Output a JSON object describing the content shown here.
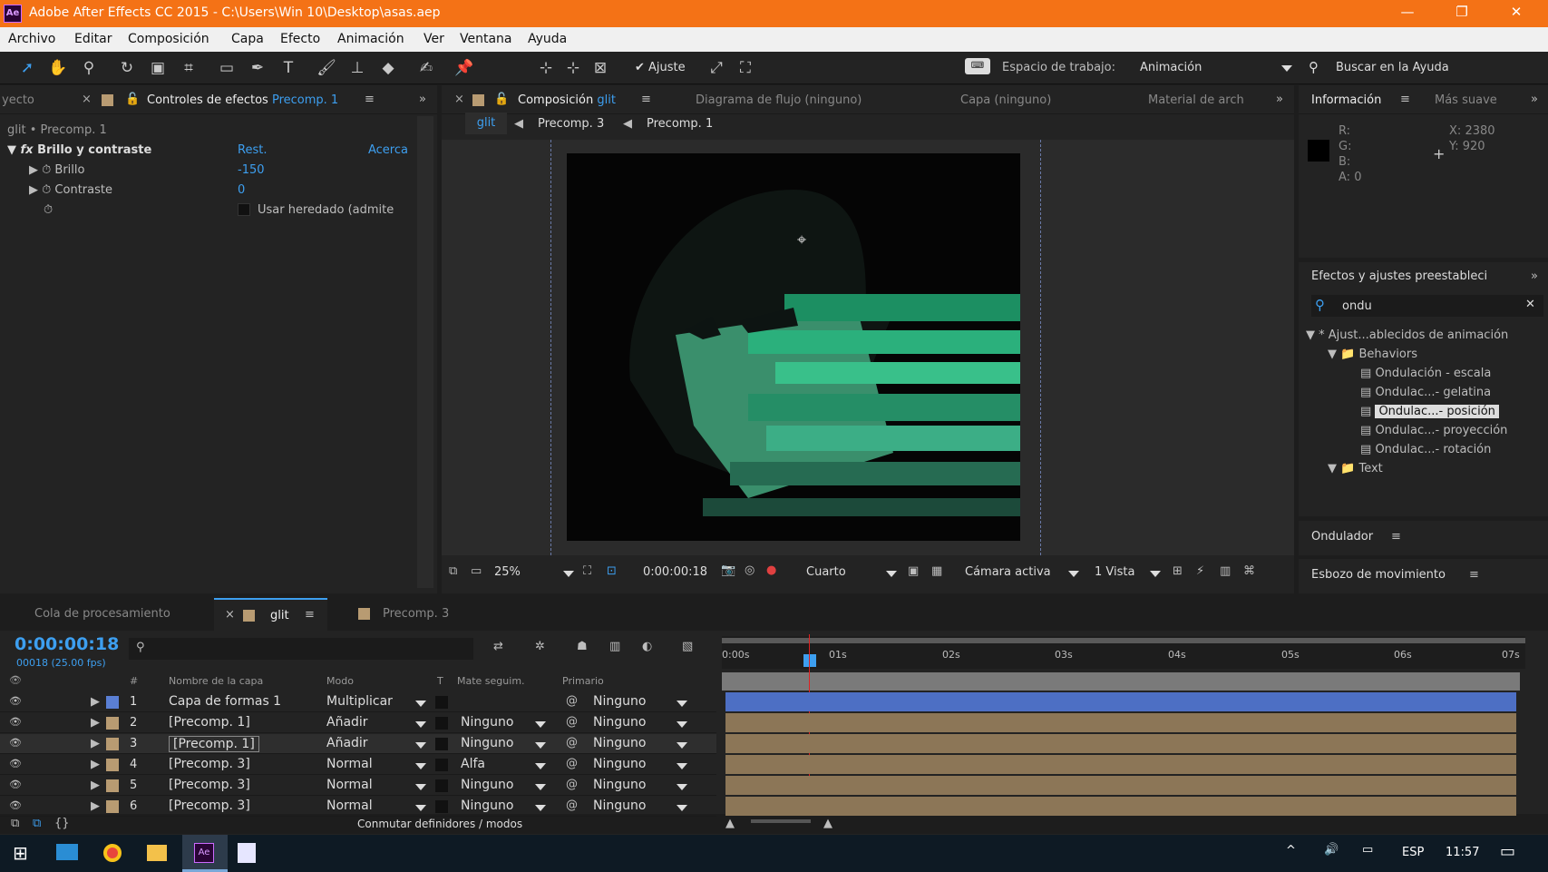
{
  "window": {
    "title": "Adobe After Effects CC 2015 - C:\\Users\\Win 10\\Desktop\\asas.aep",
    "logo": "Ae"
  },
  "menu": [
    "Archivo",
    "Editar",
    "Composición",
    "Capa",
    "Efecto",
    "Animación",
    "Ver",
    "Ventana",
    "Ayuda"
  ],
  "toolbar": {
    "snap_label": "Ajuste",
    "workspace_label": "Espacio de trabajo:",
    "workspace_value": "Animación",
    "help_placeholder": "Buscar en la Ayuda"
  },
  "effects_panel": {
    "tab_left": "yecto",
    "tab_title": "Controles de efectos",
    "tab_target": "Precomp. 1",
    "breadcrumb": "glit • Precomp. 1",
    "effect_name": "Brillo y contraste",
    "reset": "Rest.",
    "about": "Acerca",
    "props": [
      {
        "name": "Brillo",
        "value": "-150"
      },
      {
        "name": "Contraste",
        "value": "0"
      }
    ],
    "legacy": "Usar heredado (admite"
  },
  "comp_panel": {
    "tab_title": "Composición",
    "tab_target": "glit",
    "tab_flow": "Diagrama de flujo (ninguno)",
    "tab_layer": "Capa (ninguno)",
    "tab_footage": "Material de arch",
    "crumbs": [
      "glit",
      "Precomp. 3",
      "Precomp. 1"
    ],
    "zoom": "25%",
    "timecode": "0:00:00:18",
    "resolution": "Cuarto",
    "camera": "Cámara activa",
    "views": "1 Vista"
  },
  "info_panel": {
    "tab": "Información",
    "tab2": "Más suave",
    "r": "R:",
    "g": "G:",
    "b": "B:",
    "a": "A:",
    "a_val": "0",
    "x": "X:",
    "x_val": "2380",
    "y": "Y:",
    "y_val": "920"
  },
  "presets_panel": {
    "title": "Efectos y ajustes preestableci",
    "search": "ondu",
    "tree": [
      {
        "label": "* Ajust...ablecidos de animación",
        "level": 0
      },
      {
        "label": "Behaviors",
        "level": 1
      },
      {
        "label": "Ondulación - escala",
        "level": 2
      },
      {
        "label": "Ondulac...- gelatina",
        "level": 2
      },
      {
        "label": "Ondulac...- posición",
        "level": 2,
        "selected": true
      },
      {
        "label": "Ondulac...- proyección",
        "level": 2
      },
      {
        "label": "Ondulac...- rotación",
        "level": 2
      },
      {
        "label": "Text",
        "level": 1
      }
    ]
  },
  "wiggler": "Ondulador",
  "motion_sketch": "Esbozo de movimiento",
  "timeline": {
    "tabs": [
      "Cola de procesamiento",
      "glit",
      "Precomp. 3"
    ],
    "timecode": "0:00:00:18",
    "fps": "00018 (25.00 fps)",
    "headers": {
      "num": "#",
      "name": "Nombre de la capa",
      "mode": "Modo",
      "t": "T",
      "matte": "Mate seguim.",
      "parent": "Primario"
    },
    "ruler": [
      "0:00s",
      "01s",
      "02s",
      "03s",
      "04s",
      "05s",
      "06s",
      "07s"
    ],
    "layers": [
      {
        "num": "1",
        "name": "Capa de formas 1",
        "mode": "Multiplicar",
        "matte": "",
        "parent": "Ninguno",
        "color": "#5a7fd4"
      },
      {
        "num": "2",
        "name": "[Precomp. 1]",
        "mode": "Añadir",
        "matte": "Ninguno",
        "parent": "Ninguno",
        "color": "#b89b72"
      },
      {
        "num": "3",
        "name": "[Precomp. 1]",
        "mode": "Añadir",
        "matte": "Ninguno",
        "parent": "Ninguno",
        "color": "#b89b72"
      },
      {
        "num": "4",
        "name": "[Precomp. 3]",
        "mode": "Normal",
        "matte": "Alfa",
        "parent": "Ninguno",
        "color": "#b89b72"
      },
      {
        "num": "5",
        "name": "[Precomp. 3]",
        "mode": "Normal",
        "matte": "Ninguno",
        "parent": "Ninguno",
        "color": "#b89b72"
      },
      {
        "num": "6",
        "name": "[Precomp. 3]",
        "mode": "Normal",
        "matte": "Ninguno",
        "parent": "Ninguno",
        "color": "#b89b72"
      }
    ],
    "footer": "Conmutar definidores / modos"
  },
  "taskbar": {
    "lang": "ESP",
    "time": "11:57"
  }
}
